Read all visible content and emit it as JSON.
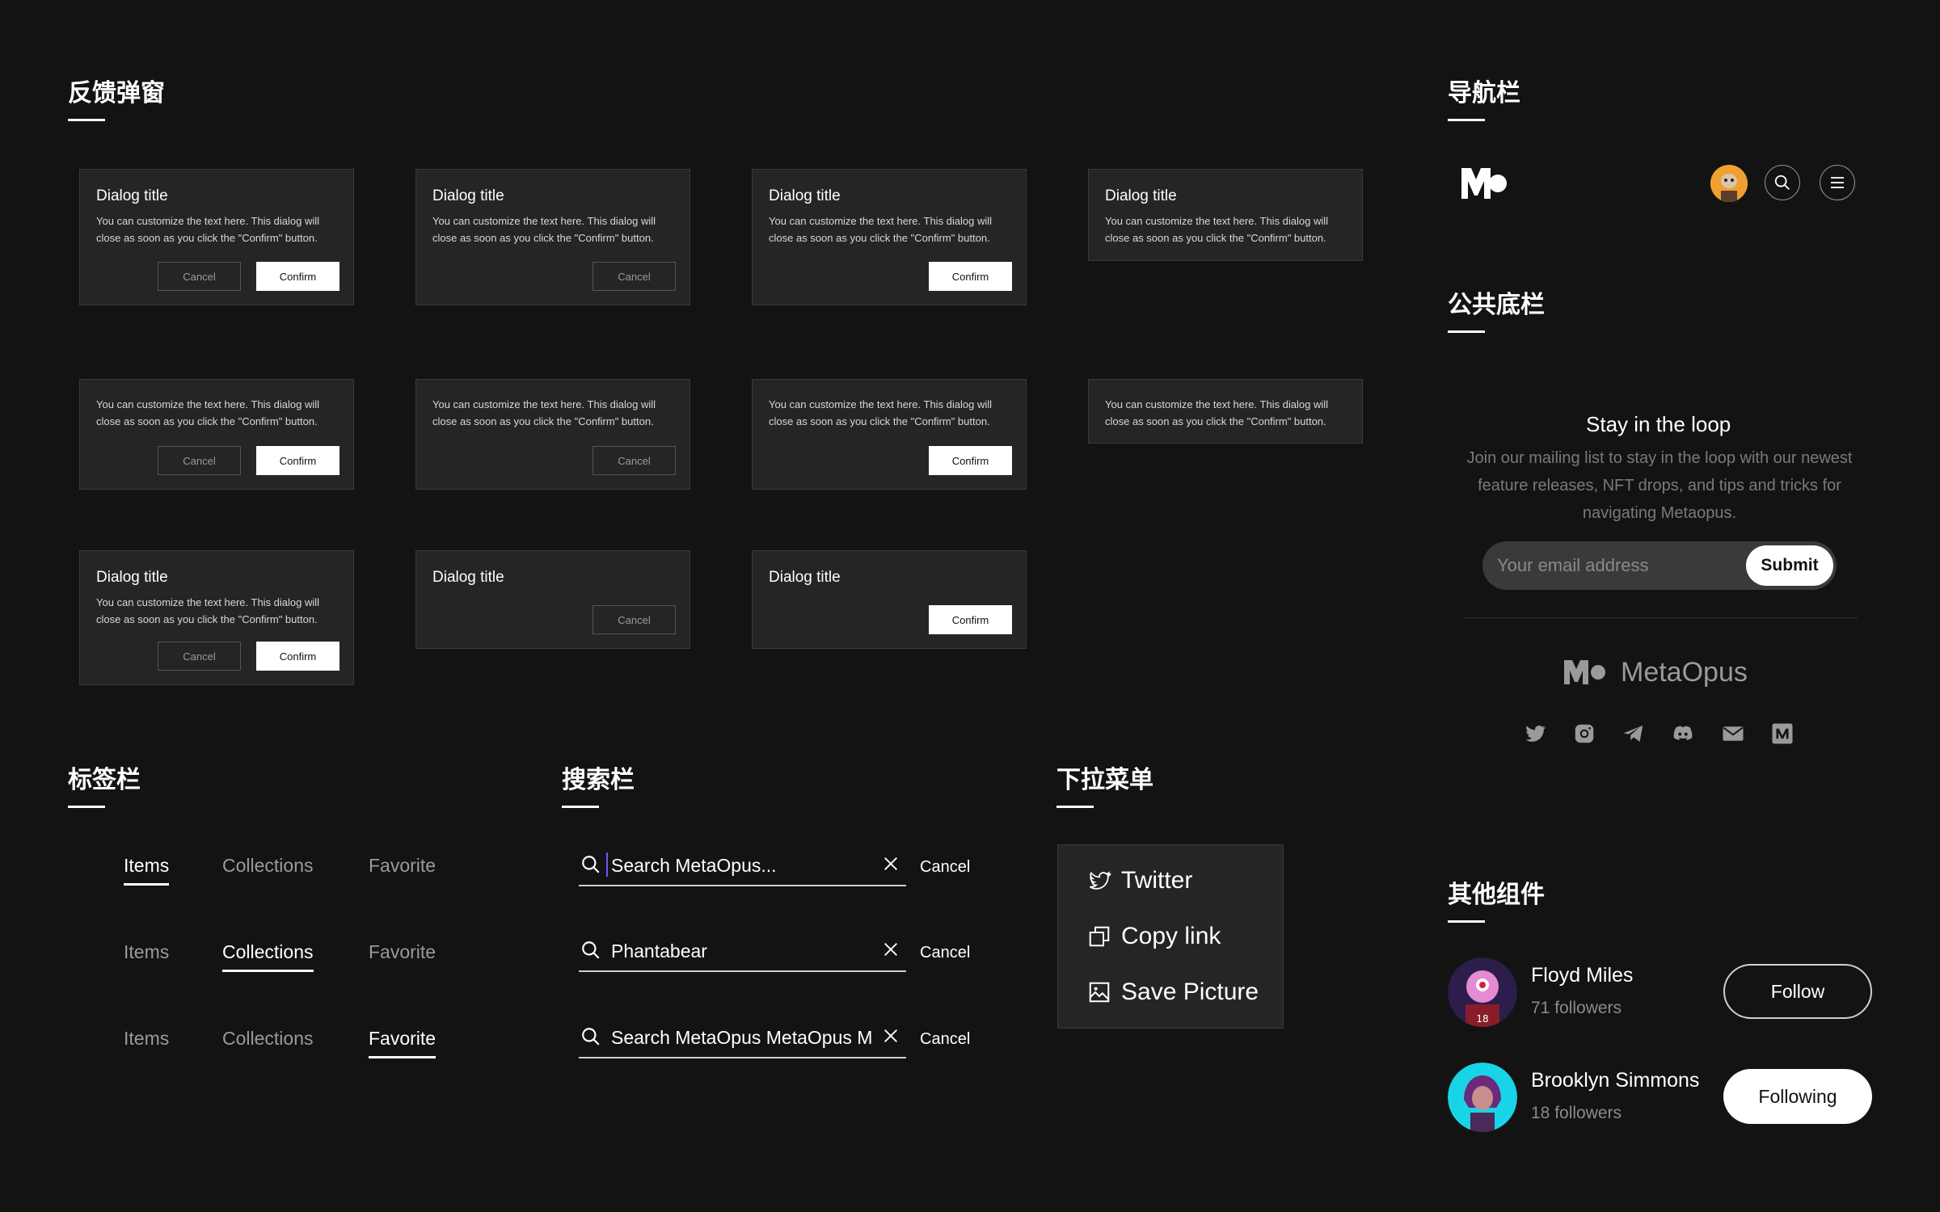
{
  "sections": {
    "feedback_dialog": "反馈弹窗",
    "navbar": "导航栏",
    "footer": "公共底栏",
    "tabbar": "标签栏",
    "searchbar": "搜索栏",
    "dropdown": "下拉菜单",
    "others": "其他组件"
  },
  "dialog": {
    "title": "Dialog title",
    "text": "You can customize the text here. This dialog will close as soon as you click the \"Confirm\" button.",
    "cancel": "Cancel",
    "confirm": "Confirm"
  },
  "tabs": {
    "labels": [
      "Items",
      "Collections",
      "Favorite"
    ]
  },
  "search": {
    "rows": [
      {
        "value": "Search MetaOpus...",
        "cancel": "Cancel"
      },
      {
        "value": "Phantabear",
        "cancel": "Cancel"
      },
      {
        "value": "Search MetaOpus MetaOpus M",
        "cancel": "Cancel"
      }
    ]
  },
  "dropdown": {
    "items": [
      {
        "label": "Twitter",
        "icon": "twitter-icon"
      },
      {
        "label": "Copy link",
        "icon": "copy-icon"
      },
      {
        "label": "Save Picture",
        "icon": "image-icon"
      }
    ]
  },
  "navbar": {
    "logo": "MO",
    "icons": [
      "avatar",
      "search-icon",
      "menu-icon"
    ]
  },
  "footer": {
    "title": "Stay in the loop",
    "text": "Join our mailing list to stay in the loop with our newest feature releases, NFT drops, and tips and tricks for navigating Metaopus.",
    "email_placeholder": "Your email address",
    "submit": "Submit",
    "brand": "MetaOpus",
    "social_icons": [
      "twitter-icon",
      "instagram-icon",
      "telegram-icon",
      "discord-icon",
      "mail-icon",
      "medium-icon"
    ]
  },
  "follow": {
    "users": [
      {
        "name": "Floyd Miles",
        "followers": "71 followers",
        "button": "Follow"
      },
      {
        "name": "Brooklyn Simmons",
        "followers": "18 followers",
        "button": "Following"
      }
    ]
  },
  "colors": {
    "background": "#131313",
    "panel": "#252525",
    "caret": "#6a5af9",
    "avatar_orange": "#f0a030",
    "avatar_cyan": "#19d3e6"
  }
}
